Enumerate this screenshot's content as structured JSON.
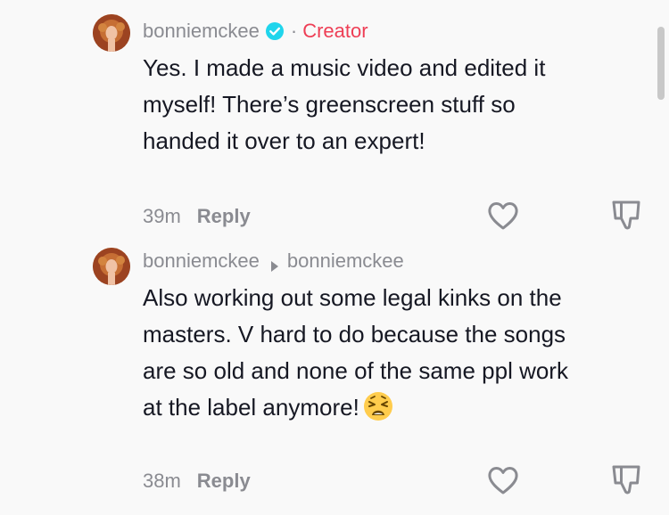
{
  "comments": [
    {
      "username": "bonniemckee",
      "separator": "·",
      "badge": "Creator",
      "text": "Yes. I made a music video and edited it myself! There’s greenscreen stuff so handed it over to an expert!",
      "time": "39m",
      "reply_label": "Reply"
    },
    {
      "username": "bonniemckee",
      "reply_to": "bonniemckee",
      "text": "Also working out some legal kinks on the masters. V hard to do because the songs are so old and none of the same ppl work at the label anymore!",
      "emoji": "weary-face",
      "time": "38m",
      "reply_label": "Reply"
    }
  ],
  "colors": {
    "background": "#f9f9f9",
    "text": "#161823",
    "muted": "#8a8b91",
    "creator": "#ee3e55",
    "verified": "#20d5ec"
  },
  "icons": [
    "verified-icon",
    "reply-arrow-icon",
    "like-icon",
    "dislike-icon",
    "weary-face-emoji"
  ]
}
